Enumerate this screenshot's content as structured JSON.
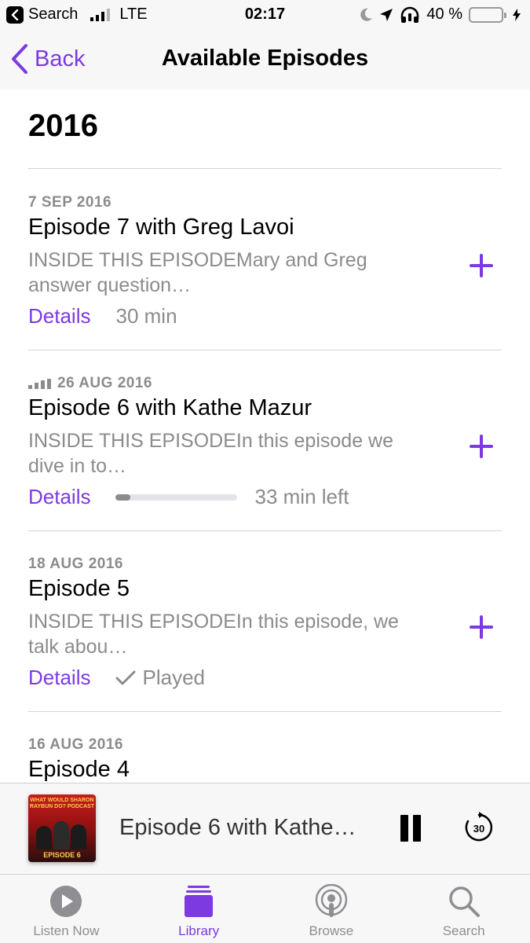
{
  "status_bar": {
    "back_app": "Search",
    "carrier": "LTE",
    "time": "02:17",
    "battery": "40 %",
    "battery_level": 0.4
  },
  "nav": {
    "back_label": "Back",
    "title": "Available Episodes"
  },
  "year": "2016",
  "episodes": [
    {
      "date": "7 SEP 2016",
      "title": "Episode 7 with Greg Lavoi",
      "description": "INSIDE THIS EPISODEMary and Greg answer question…",
      "details_label": "Details",
      "status": "30 min"
    },
    {
      "date": "26 AUG 2016",
      "title": "Episode 6 with Kathe Mazur",
      "description": "INSIDE THIS EPISODEIn this episode we dive in to…",
      "details_label": "Details",
      "status": "33 min left",
      "progress": 0.12
    },
    {
      "date": "18 AUG 2016",
      "title": "Episode 5",
      "description": "INSIDE THIS EPISODEIn this episode, we talk abou…",
      "details_label": "Details",
      "status": "Played"
    },
    {
      "date": "16 AUG 2016",
      "title": "Episode 4"
    }
  ],
  "player": {
    "title": "Episode 6 with Kathe…",
    "skip_seconds": "30",
    "artwork_text": "WHAT WOULD SHARON RAYBUN DO? PODCAST",
    "artwork_episode": "EPISODE 6"
  },
  "tabs": [
    {
      "label": "Listen Now",
      "icon": "play-circle-icon"
    },
    {
      "label": "Library",
      "icon": "library-stack-icon"
    },
    {
      "label": "Browse",
      "icon": "podcasts-icon"
    },
    {
      "label": "Search",
      "icon": "search-icon"
    }
  ],
  "colors": {
    "accent": "#7c3ae0",
    "secondary_text": "#8b8b8b",
    "battery_green": "#4cd964"
  }
}
